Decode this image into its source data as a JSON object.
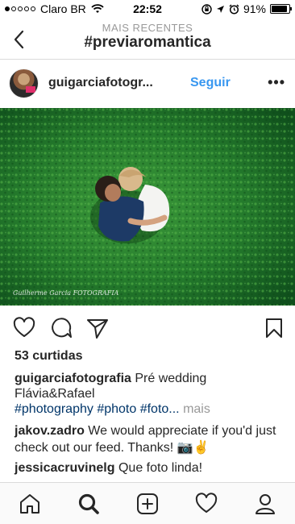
{
  "status_bar": {
    "carrier": "Claro BR",
    "time": "22:52",
    "battery": "91%",
    "battery_level": 0.91
  },
  "nav": {
    "subtitle": "MAIS RECENTES",
    "title": "#previaromantica"
  },
  "post": {
    "username": "guigarciafotogr...",
    "follow_label": "Seguir",
    "photo_watermark": "Guilherme Garcia FOTOGRAFIA",
    "likes": "53 curtidas",
    "caption_user": "guigarciafotografia",
    "caption_text": "Pré wedding Flávia&Rafael",
    "hashtags": [
      "#photography",
      "#photo",
      "#foto..."
    ],
    "more_label": "mais",
    "comments": [
      {
        "user": "jakov.zadro",
        "text": "We would appreciate if you'd just check out our feed. Thanks! 📷✌️"
      },
      {
        "user": "jessicacruvinelg",
        "text": "Que foto linda!"
      }
    ]
  },
  "icons": {
    "back": "chevron-left-icon",
    "more": "more-horizontal-icon",
    "like": "heart-icon",
    "comment": "comment-icon",
    "share": "send-icon",
    "save": "bookmark-icon",
    "home": "home-icon",
    "search": "search-icon",
    "add": "add-post-icon",
    "activity": "heart-icon",
    "profile": "profile-icon"
  },
  "colors": {
    "link_blue": "#3897f0",
    "hashtag": "#003569",
    "grass": "#1f6d28"
  }
}
